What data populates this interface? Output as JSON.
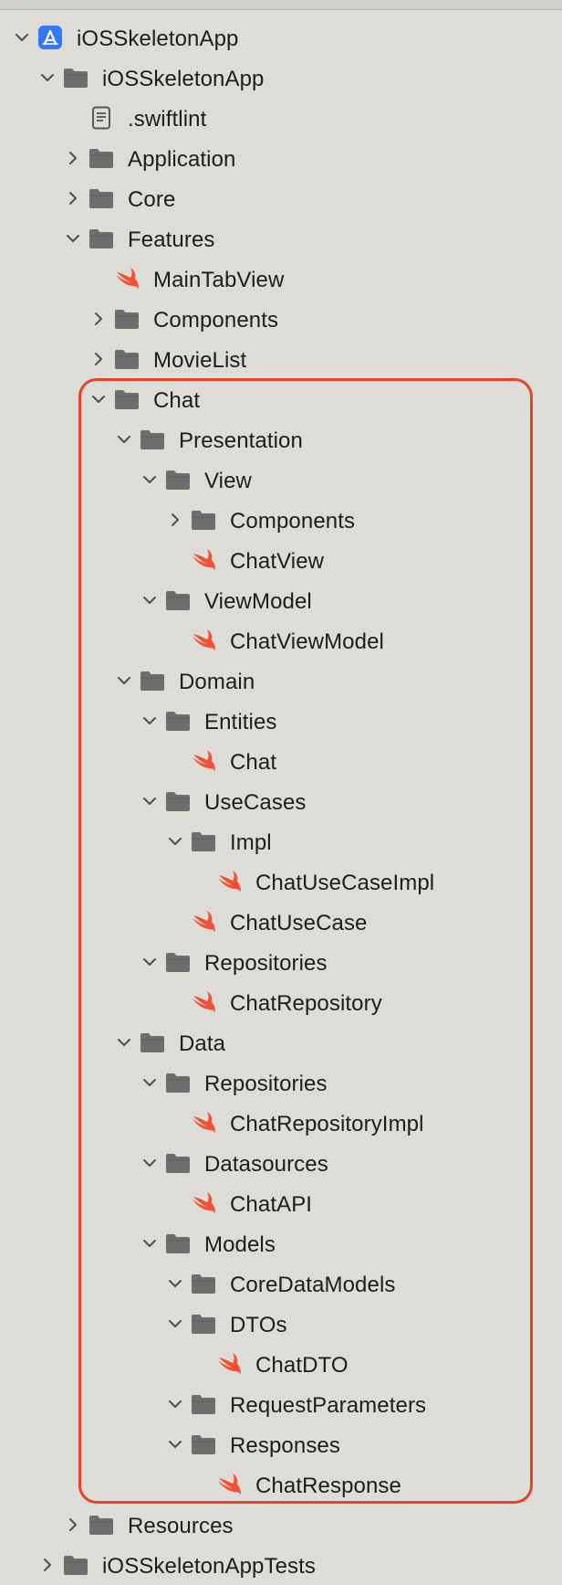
{
  "window": {
    "title": "iOSSkeletonApp"
  },
  "tree": [
    {
      "label": "iOSSkeletonApp",
      "type": "project",
      "level": 0,
      "chevron": "down"
    },
    {
      "label": "iOSSkeletonApp",
      "type": "folder",
      "level": 1,
      "chevron": "down"
    },
    {
      "label": ".swiftlint",
      "type": "file",
      "level": 2,
      "chevron": ""
    },
    {
      "label": "Application",
      "type": "folder",
      "level": 2,
      "chevron": "right"
    },
    {
      "label": "Core",
      "type": "folder",
      "level": 2,
      "chevron": "right"
    },
    {
      "label": "Features",
      "type": "folder",
      "level": 2,
      "chevron": "down"
    },
    {
      "label": "MainTabView",
      "type": "swift",
      "level": 3,
      "chevron": ""
    },
    {
      "label": "Components",
      "type": "folder",
      "level": 3,
      "chevron": "right"
    },
    {
      "label": "MovieList",
      "type": "folder",
      "level": 3,
      "chevron": "right"
    },
    {
      "label": "Chat",
      "type": "folder",
      "level": 3,
      "chevron": "down"
    },
    {
      "label": "Presentation",
      "type": "folder",
      "level": 4,
      "chevron": "down"
    },
    {
      "label": "View",
      "type": "folder",
      "level": 5,
      "chevron": "down"
    },
    {
      "label": "Components",
      "type": "folder",
      "level": 6,
      "chevron": "right"
    },
    {
      "label": "ChatView",
      "type": "swift",
      "level": 6,
      "chevron": ""
    },
    {
      "label": "ViewModel",
      "type": "folder",
      "level": 5,
      "chevron": "down"
    },
    {
      "label": "ChatViewModel",
      "type": "swift",
      "level": 6,
      "chevron": ""
    },
    {
      "label": "Domain",
      "type": "folder",
      "level": 4,
      "chevron": "down"
    },
    {
      "label": "Entities",
      "type": "folder",
      "level": 5,
      "chevron": "down"
    },
    {
      "label": "Chat",
      "type": "swift",
      "level": 6,
      "chevron": ""
    },
    {
      "label": "UseCases",
      "type": "folder",
      "level": 5,
      "chevron": "down"
    },
    {
      "label": "Impl",
      "type": "folder",
      "level": 6,
      "chevron": "down"
    },
    {
      "label": "ChatUseCaseImpl",
      "type": "swift",
      "level": 7,
      "chevron": ""
    },
    {
      "label": "ChatUseCase",
      "type": "swift",
      "level": 6,
      "chevron": ""
    },
    {
      "label": "Repositories",
      "type": "folder",
      "level": 5,
      "chevron": "down"
    },
    {
      "label": "ChatRepository",
      "type": "swift",
      "level": 6,
      "chevron": ""
    },
    {
      "label": "Data",
      "type": "folder",
      "level": 4,
      "chevron": "down"
    },
    {
      "label": "Repositories",
      "type": "folder",
      "level": 5,
      "chevron": "down"
    },
    {
      "label": "ChatRepositoryImpl",
      "type": "swift",
      "level": 6,
      "chevron": ""
    },
    {
      "label": "Datasources",
      "type": "folder",
      "level": 5,
      "chevron": "down"
    },
    {
      "label": "ChatAPI",
      "type": "swift",
      "level": 6,
      "chevron": ""
    },
    {
      "label": "Models",
      "type": "folder",
      "level": 5,
      "chevron": "down"
    },
    {
      "label": "CoreDataModels",
      "type": "folder",
      "level": 6,
      "chevron": "down"
    },
    {
      "label": "DTOs",
      "type": "folder",
      "level": 6,
      "chevron": "down"
    },
    {
      "label": "ChatDTO",
      "type": "swift",
      "level": 7,
      "chevron": ""
    },
    {
      "label": "RequestParameters",
      "type": "folder",
      "level": 6,
      "chevron": "down"
    },
    {
      "label": "Responses",
      "type": "folder",
      "level": 6,
      "chevron": "down"
    },
    {
      "label": "ChatResponse",
      "type": "swift",
      "level": 7,
      "chevron": ""
    },
    {
      "label": "Resources",
      "type": "folder",
      "level": 2,
      "chevron": "right"
    },
    {
      "label": "iOSSkeletonAppTests",
      "type": "folder",
      "level": 1,
      "chevron": "right"
    }
  ],
  "highlight": {
    "color": "#e5432b",
    "target": "Chat"
  },
  "colors": {
    "background": "#dedcd6",
    "folder": "#6e6e6e",
    "swift": "#f05138",
    "project": "#3478f6",
    "text": "#1d1d1f"
  },
  "icons": {
    "project": "xcode-app-icon",
    "folder": "folder-icon",
    "file": "document-icon",
    "swift": "swift-icon",
    "chevron_down": "chevron-down-icon",
    "chevron_right": "chevron-right-icon"
  }
}
